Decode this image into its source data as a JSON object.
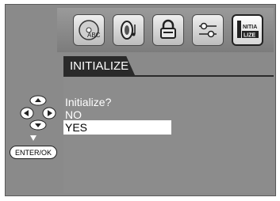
{
  "menu": {
    "icons": [
      {
        "name": "language-disc-icon",
        "label": "ABC"
      },
      {
        "name": "audio-speaker-icon",
        "label": ""
      },
      {
        "name": "lock-icon",
        "label": ""
      },
      {
        "name": "settings-sliders-icon",
        "label": ""
      },
      {
        "name": "initialize-icon",
        "label_top": "NITIA",
        "label_bottom": "LIZE"
      }
    ]
  },
  "tab": {
    "title": "INITIALIZE"
  },
  "dialog": {
    "question": "Initialize?",
    "options": [
      "NO",
      "YES"
    ],
    "selected": "YES"
  },
  "controls": {
    "enter_label": "ENTER/OK"
  }
}
